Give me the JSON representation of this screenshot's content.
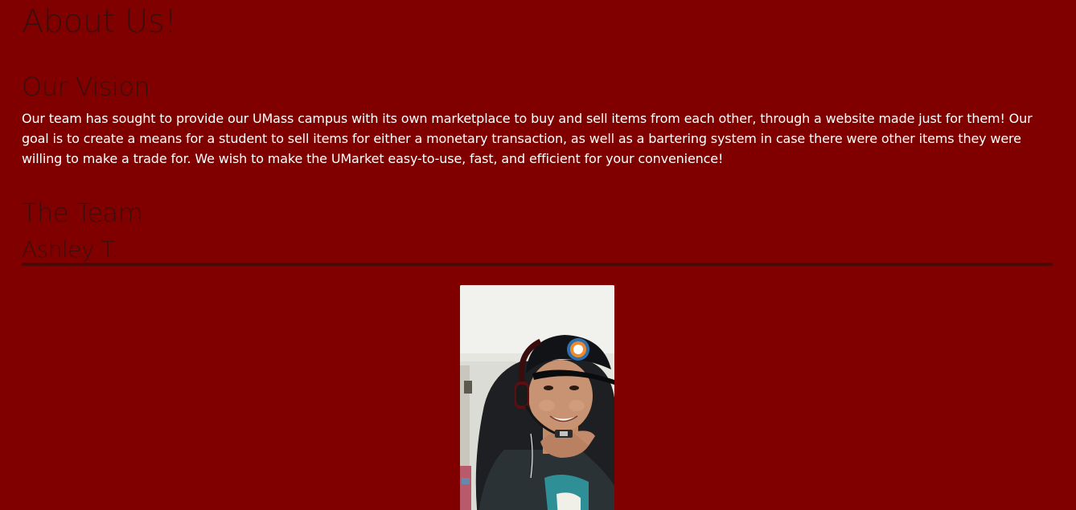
{
  "page": {
    "title": "About Us!",
    "background_color": "#800000",
    "heading_color": "#3a0e0e",
    "text_color": "#ffffff"
  },
  "vision": {
    "heading": "Our Vision",
    "body": "Our team has sought to provide our UMass campus with its own marketplace to buy and sell items from each other, through a website made just for them! Our goal is to create a means for a student to sell items for either a monetary transaction, as well as a bartering system in case there were other items they were willing to make a trade for. We wish to make the UMarket easy-to-use, fast, and efficient for your convenience!"
  },
  "team": {
    "heading": "The Team",
    "members": [
      {
        "name": "Ashley T.",
        "photo_icon": "member-photo"
      }
    ]
  }
}
